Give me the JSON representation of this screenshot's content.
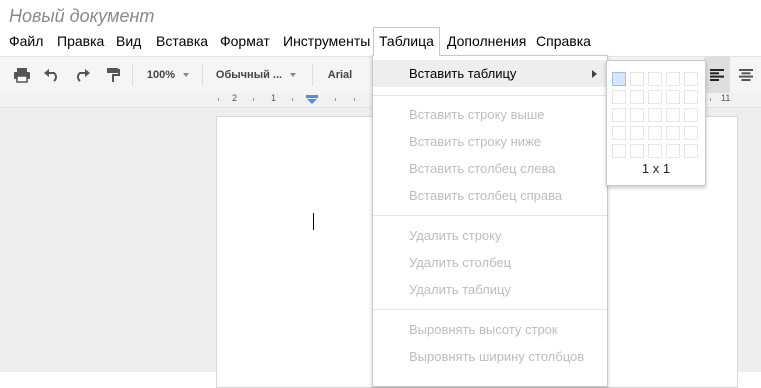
{
  "document": {
    "title": "Новый документ"
  },
  "menubar": {
    "items": [
      "Файл",
      "Правка",
      "Вид",
      "Вставка",
      "Формат",
      "Инструменты",
      "Таблица",
      "Дополнения",
      "Справка"
    ],
    "open_item": "Таблица"
  },
  "toolbar": {
    "zoom": "100%",
    "style": "Обычный ...",
    "font": "Arial",
    "icons": [
      "print-icon",
      "undo-icon",
      "redo-icon",
      "paint-format-icon",
      "align-left-icon",
      "align-center-icon"
    ]
  },
  "ruler": {
    "numbers": [
      "2",
      "1",
      "11"
    ]
  },
  "table_menu": {
    "insert_table": "Вставить таблицу",
    "items": [
      "Вставить строку выше",
      "Вставить строку ниже",
      "Вставить столбец слева",
      "Вставить столбец справа",
      "Удалить строку",
      "Удалить столбец",
      "Удалить таблицу",
      "Выровнять высоту строк",
      "Выровнять ширину столбцов"
    ]
  },
  "table_grid": {
    "size_label": "1 x 1",
    "rows": 5,
    "cols": 5,
    "selected": [
      1,
      1
    ]
  },
  "colors": {
    "selected_cell": "#d6e6fb",
    "disabled_text": "#bdbdbd"
  }
}
